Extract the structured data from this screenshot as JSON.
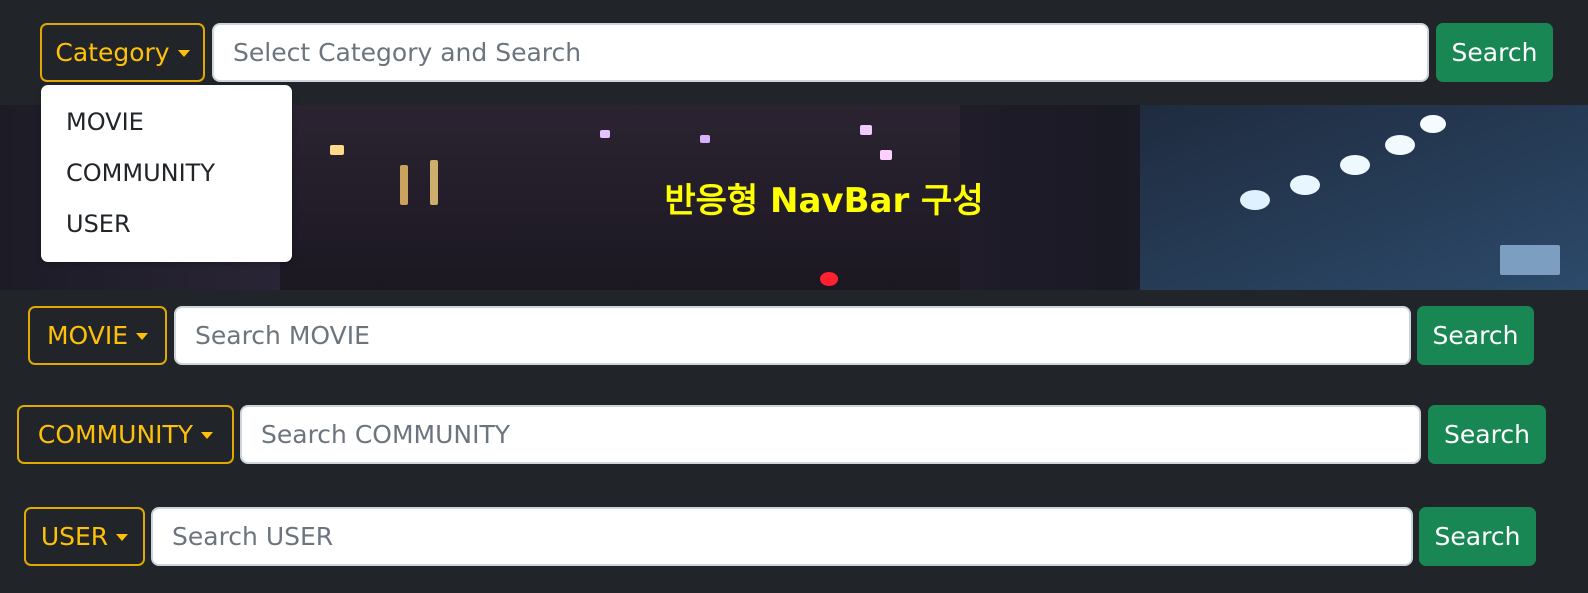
{
  "top_bar": {
    "category_button": "Category",
    "search_placeholder": "Select Category and Search",
    "search_button": "Search"
  },
  "dropdown": {
    "items": [
      {
        "label": "MOVIE"
      },
      {
        "label": "COMMUNITY"
      },
      {
        "label": "USER"
      }
    ]
  },
  "hero": {
    "title": "반응형 NavBar 구성",
    "title_color": "#ffff00"
  },
  "bars": [
    {
      "category_button": "MOVIE",
      "search_placeholder": "Search MOVIE",
      "search_button": "Search"
    },
    {
      "category_button": "COMMUNITY",
      "search_placeholder": "Search COMMUNITY",
      "search_button": "Search"
    },
    {
      "category_button": "USER",
      "search_placeholder": "Search USER",
      "search_button": "Search"
    }
  ],
  "colors": {
    "background": "#212529",
    "accent_warning": "#ffc107",
    "search_button": "#198754"
  },
  "icons": {
    "caret": "caret-down-icon"
  }
}
